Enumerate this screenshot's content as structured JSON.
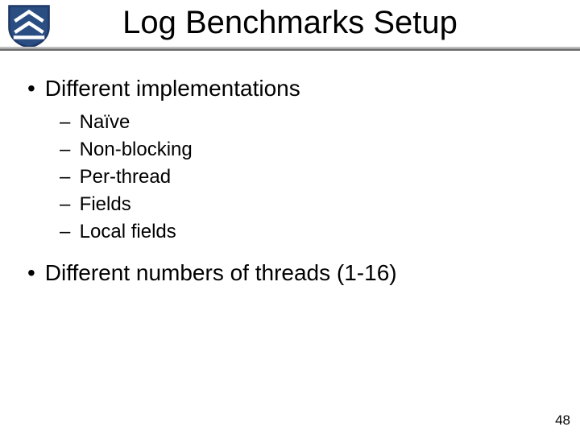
{
  "title": "Log Benchmarks Setup",
  "logo": {
    "icon": "rice-shield-icon",
    "border": "#1f3a68",
    "fill": "#2a4d82",
    "chevron": "#ffffff"
  },
  "bullets": [
    {
      "text": "Different implementations",
      "children": [
        {
          "text": "Naïve"
        },
        {
          "text": "Non-blocking"
        },
        {
          "text": "Per-thread"
        },
        {
          "text": "Fields"
        },
        {
          "text": "Local fields"
        }
      ]
    },
    {
      "text": "Different numbers of threads (1-16)",
      "children": []
    }
  ],
  "page_number": "48"
}
